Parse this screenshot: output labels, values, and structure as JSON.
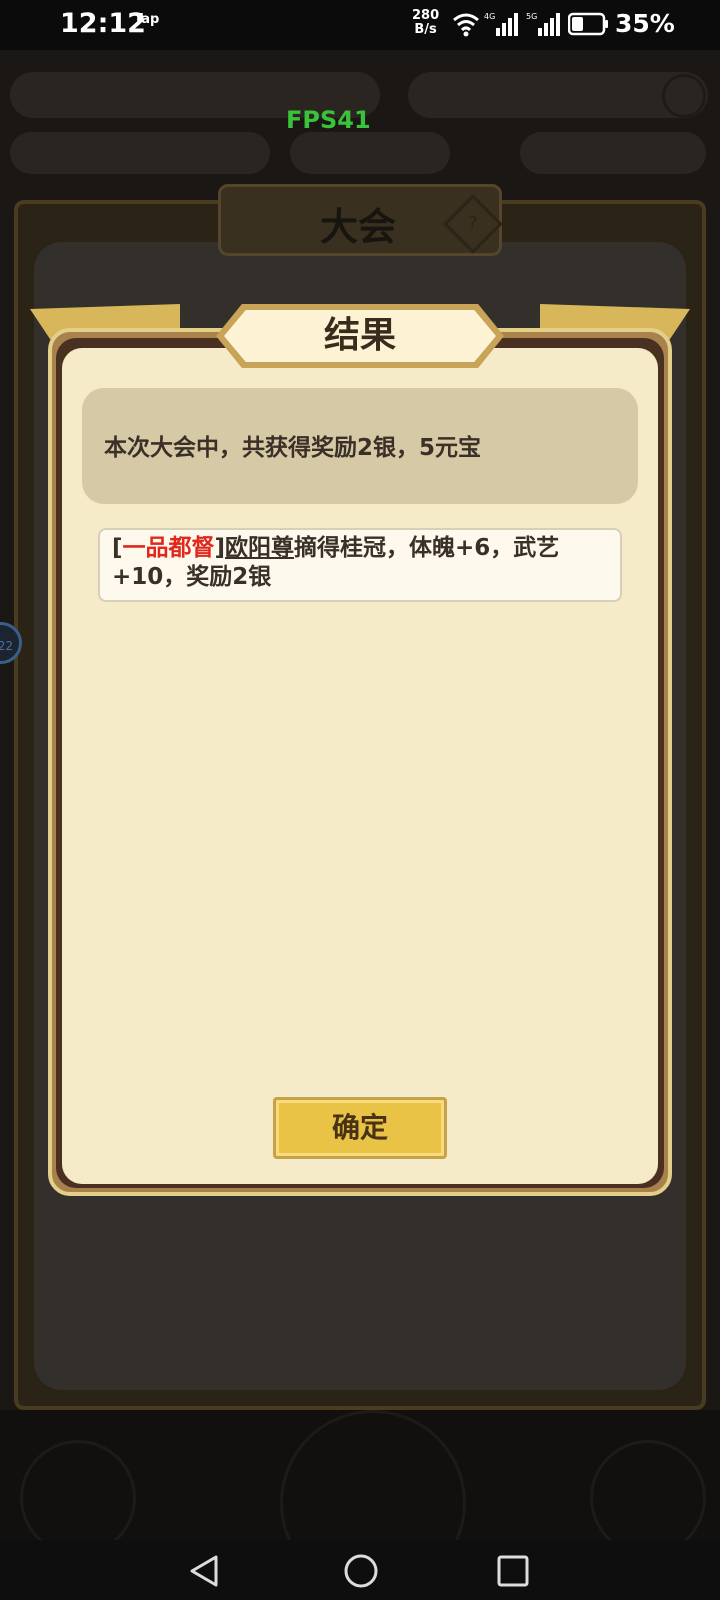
{
  "status_bar": {
    "time": "12:12",
    "tap_label": "Tap",
    "net_speed_value": "280",
    "net_speed_unit": "B/s",
    "network_labels": [
      "4G",
      "5G"
    ],
    "battery_percent": "35%"
  },
  "overlay": {
    "fps_label": "FPS41"
  },
  "background_screen": {
    "title": "大会",
    "help_symbol": "?",
    "side_badge": "22"
  },
  "result_dialog": {
    "title": "结果",
    "summary": "本次大会中，共获得奖励2银，5元宝",
    "records": [
      {
        "bracket_open": "[",
        "rank": "一品都督",
        "bracket_close": "]",
        "hero": "欧阳尊",
        "outcome": "摘得桂冠，体魄+6，武艺+10，奖励2银"
      }
    ],
    "confirm_label": "确定"
  },
  "colors": {
    "rank_red": "#e0291c",
    "fps_green": "#39c23a",
    "button_gold": "#e9c346",
    "panel_cream": "#f5ebc8"
  },
  "icons": {
    "wifi": "wifi-icon",
    "signal": "signal-icon",
    "battery": "battery-icon",
    "back": "back-triangle-icon",
    "home": "home-circle-icon",
    "recents": "recents-square-icon"
  }
}
